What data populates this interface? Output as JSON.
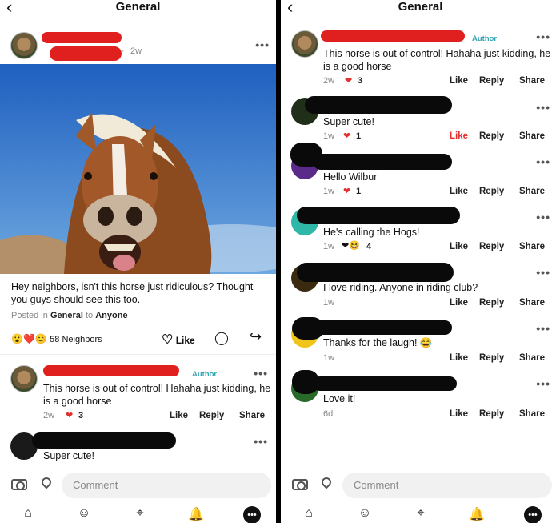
{
  "header": {
    "title": "General",
    "back_icon": "chevron-left-icon"
  },
  "post": {
    "time": "2w",
    "body": "Hey neighbors, isn't this horse just ridiculous? Thought you guys should see this too.",
    "posted_in_prefix": "Posted in",
    "group": "General",
    "to_label": "to",
    "audience": "Anyone",
    "reactions_count": "58 Neighbors",
    "like_label": "Like"
  },
  "comments": [
    {
      "author_tag": "Author",
      "text": "This horse is out of control! Hahaha just kidding, he is a good horse",
      "time": "2w",
      "likes": "3"
    },
    {
      "text": "Super cute!",
      "time": "1w",
      "likes": "1",
      "liked": true
    },
    {
      "text": "Hello Wilbur",
      "time": "1w",
      "likes": "1"
    },
    {
      "text": "He's calling the Hogs!",
      "time": "1w",
      "likes": "4"
    },
    {
      "text": "I love riding.  Anyone in  riding club?",
      "time": "1w",
      "likes": ""
    },
    {
      "text": "Thanks for the laugh! 😂",
      "time": "1w",
      "likes": ""
    },
    {
      "text": "Love it!",
      "time": "6d",
      "likes": ""
    }
  ],
  "actions": {
    "like": "Like",
    "reply": "Reply",
    "share": "Share"
  },
  "composer": {
    "placeholder": "Comment"
  },
  "colors": {
    "accent": "#35a6b4",
    "heart": "#e0302e",
    "redaction": "#e0201e"
  }
}
